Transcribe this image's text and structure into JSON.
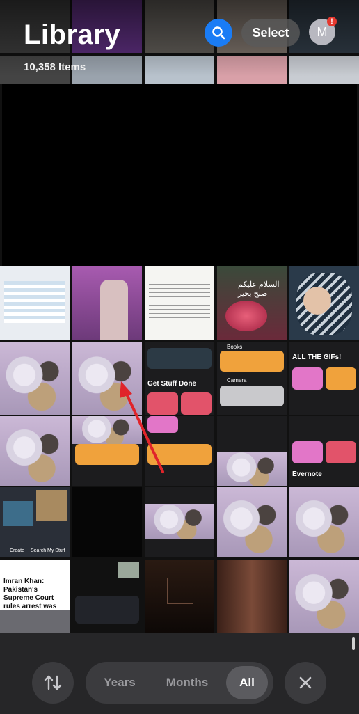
{
  "header": {
    "title": "Library",
    "item_count": "10,358 Items",
    "select_label": "Select",
    "avatar_initial": "M",
    "badge": "!"
  },
  "thumbnails": {
    "news_headline": "Imran Khan: Pakistan's Supreme Court rules arrest was illegal",
    "greeting_text": "السلام عليكم صبح بخير",
    "shortcut_get_stuff_done": "Get Stuff Done",
    "shortcut_books": "Books",
    "shortcut_camera": "Camera",
    "shortcut_evernote": "Evernote",
    "shortcut_all_gifs": "ALL THE GIFs!",
    "tab_create": "Create",
    "tab_search": "Search",
    "tab_mystuff": "My Stuff"
  },
  "bottom_bar": {
    "segments": [
      "Years",
      "Months",
      "All"
    ],
    "selected": "All"
  },
  "colors": {
    "accent_blue": "#1a7cf5",
    "badge_red": "#e5382e",
    "bar_bg": "#262628",
    "control_bg": "#3b3b3e"
  },
  "icons": [
    "search-icon",
    "sort-arrows-icon",
    "close-icon"
  ]
}
